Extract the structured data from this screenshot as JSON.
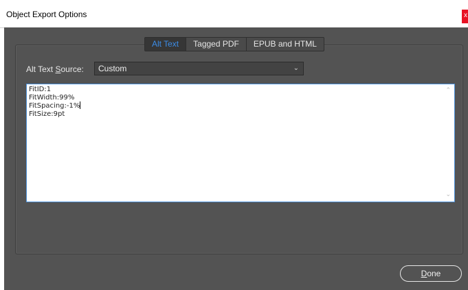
{
  "window": {
    "title": "Object Export Options",
    "close_label": "x"
  },
  "tabs": [
    {
      "label": "Alt Text",
      "active": true
    },
    {
      "label": "Tagged PDF",
      "active": false
    },
    {
      "label": "EPUB and HTML",
      "active": false
    }
  ],
  "alt_text": {
    "source_label_pre": "Alt Text ",
    "source_label_underlined": "S",
    "source_label_post": "ource:",
    "source_value": "Custom",
    "text_lines": [
      "FitID:1",
      "FitWidth:99%",
      "FitSpacing:-1%",
      "FitSize:9pt"
    ]
  },
  "footer": {
    "done_underlined": "D",
    "done_rest": "one"
  },
  "colors": {
    "dialog_bg": "#535353",
    "active_tab_text": "#3c8ce6",
    "textarea_border": "#4a8fd8",
    "close_button": "#e81123"
  },
  "icons": {
    "dropdown": "chevron-down-icon",
    "scroll_up": "scroll-up-icon",
    "scroll_down": "scroll-down-icon"
  }
}
